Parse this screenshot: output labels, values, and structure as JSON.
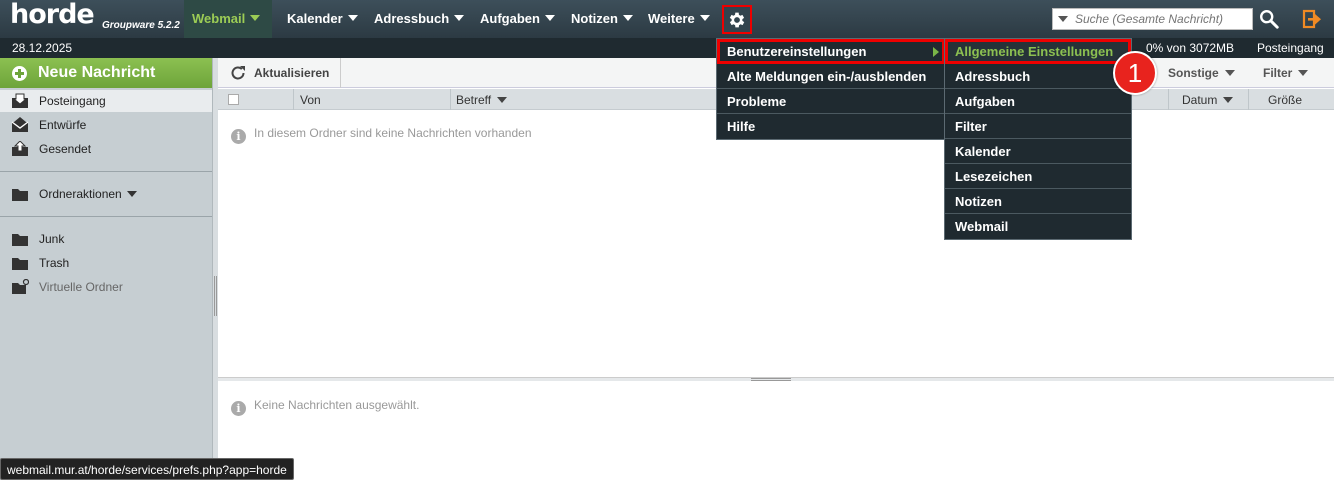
{
  "app": {
    "logo_text": "horde",
    "version": "Groupware 5.2.2"
  },
  "nav": {
    "items": [
      {
        "label": "Webmail"
      },
      {
        "label": "Kalender"
      },
      {
        "label": "Adressbuch"
      },
      {
        "label": "Aufgaben"
      },
      {
        "label": "Notizen"
      },
      {
        "label": "Weitere"
      }
    ],
    "settings_icon": "gear-icon"
  },
  "search": {
    "placeholder": "Suche (Gesamte Nachricht)",
    "button_icon": "magnifier-icon"
  },
  "logout_icon": "logout-icon",
  "subbar": {
    "date": "28.12.2025",
    "quota": "0% von 3072MB",
    "current_folder": "Posteingang"
  },
  "sidebar": {
    "new_message": "Neue Nachricht",
    "folders": [
      {
        "label": "Posteingang",
        "icon": "inbox-icon",
        "active": true
      },
      {
        "label": "Entwürfe",
        "icon": "drafts-icon"
      },
      {
        "label": "Gesendet",
        "icon": "sent-icon"
      }
    ],
    "folder_actions": "Ordneraktionen",
    "extra_folders": [
      {
        "label": "Junk",
        "icon": "folder-icon"
      },
      {
        "label": "Trash",
        "icon": "folder-icon"
      },
      {
        "label": "Virtuelle Ordner",
        "icon": "virtual-folder-icon"
      }
    ]
  },
  "toolbar": {
    "refresh": "Aktualisieren",
    "other": "Sonstige",
    "filter": "Filter"
  },
  "list": {
    "columns": {
      "from": "Von",
      "subject": "Betreff",
      "date": "Datum",
      "size": "Größe"
    },
    "empty_text": "In diesem Ordner sind keine Nachrichten vorhanden"
  },
  "preview": {
    "empty_text": "Keine Nachrichten ausgewählt."
  },
  "status_url": "webmail.mur.at/horde/services/prefs.php?app=horde",
  "settings_menu": {
    "items": [
      {
        "label": "Benutzereinstellungen",
        "highlighted": true
      },
      {
        "label": "Alte Meldungen ein-/ausblenden"
      },
      {
        "label": "Probleme"
      },
      {
        "label": "Hilfe"
      }
    ]
  },
  "prefs_submenu": {
    "items": [
      {
        "label": "Allgemeine Einstellungen",
        "highlighted": true
      },
      {
        "label": "Adressbuch"
      },
      {
        "label": "Aufgaben"
      },
      {
        "label": "Filter"
      },
      {
        "label": "Kalender"
      },
      {
        "label": "Lesezeichen"
      },
      {
        "label": "Notizen"
      },
      {
        "label": "Webmail"
      }
    ]
  },
  "step_badge": "1",
  "colors": {
    "topbar": "#2c3a43",
    "accent_green": "#8cc051",
    "highlight_red": "#e00000"
  }
}
